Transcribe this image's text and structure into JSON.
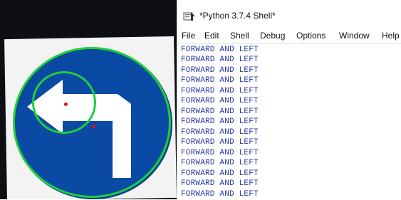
{
  "window": {
    "title": "*Python 3.7.4 Shell*"
  },
  "menu": [
    "File",
    "Edit",
    "Shell",
    "Debug",
    "Options",
    "Window",
    "Help"
  ],
  "output_lines": [
    "FORWARD AND LEFT",
    "FORWARD AND LEFT",
    "FORWARD AND LEFT",
    "FORWARD AND LEFT",
    "FORWARD AND LEFT",
    "FORWARD AND LEFT",
    "FORWARD AND LEFT",
    "FORWARD AND LEFT",
    "FORWARD AND LEFT",
    "FORWARD AND LEFT",
    "FORWARD AND LEFT",
    "FORWARD AND LEFT",
    "FORWARD AND LEFT",
    "FORWARD AND LEFT",
    "FORWARD AND LEFT"
  ],
  "colors": {
    "detection_circle": "#1ecf3a",
    "sign_blue": "#0b4aa4",
    "output_text": "#2a3aa0",
    "center_dot": "#d11111"
  },
  "icons": {
    "shell_title_icon": "idle-shell-icon",
    "sign_arrow": "turn-left-arrow-icon"
  }
}
